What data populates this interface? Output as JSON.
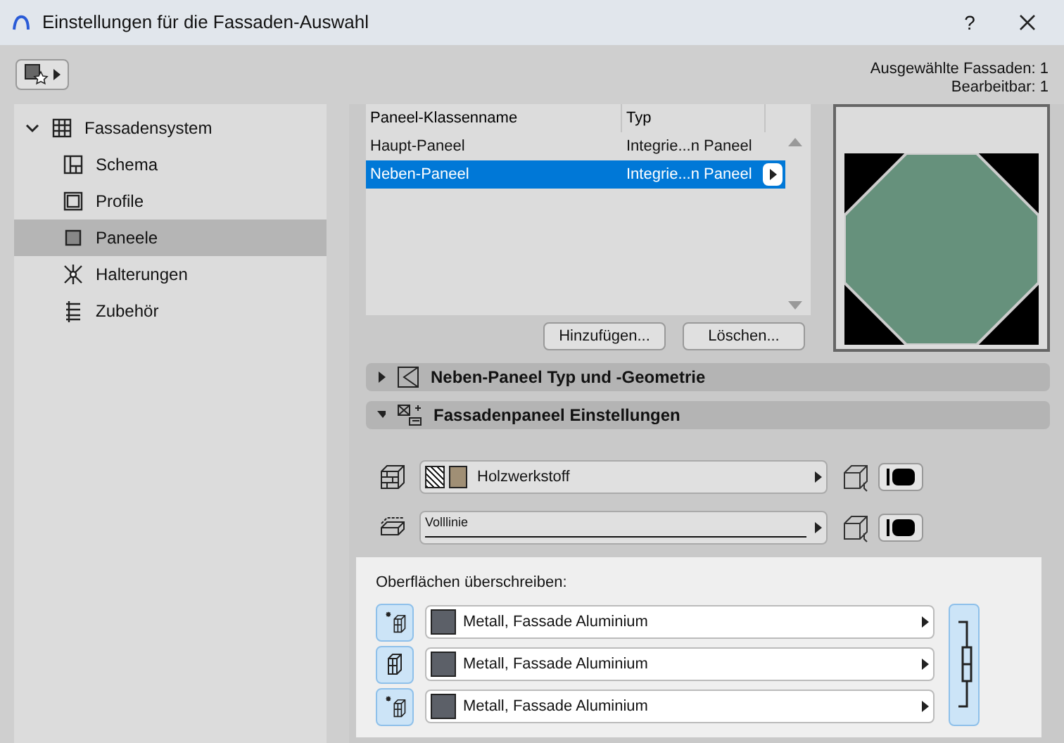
{
  "window": {
    "title": "Einstellungen für die Fassaden-Auswahl",
    "help": "?"
  },
  "info": [
    "Ausgewählte Fassaden: 1",
    "Bearbeitbar: 1"
  ],
  "sidebar": {
    "items": [
      {
        "label": "Fassadensystem",
        "expanded": true,
        "selected": false,
        "children": [
          {
            "label": "Schema",
            "selected": false
          },
          {
            "label": "Profile",
            "selected": false
          },
          {
            "label": "Paneele",
            "selected": true
          },
          {
            "label": "Halterungen",
            "selected": false
          },
          {
            "label": "Zubehör",
            "selected": false
          }
        ]
      }
    ]
  },
  "table": {
    "columns": [
      "Paneel-Klassenname",
      "Typ"
    ],
    "rows": [
      {
        "cells": [
          "Haupt-Paneel",
          "Integrie...n Paneel"
        ],
        "selected": false
      },
      {
        "cells": [
          "Neben-Paneel",
          "Integrie...n Paneel"
        ],
        "selected": true
      }
    ]
  },
  "buttons": [
    "Hinzufügen...",
    "Löschen..."
  ],
  "sections": [
    {
      "title": "Neben-Paneel Typ und -Geometrie",
      "expanded": false
    },
    {
      "title": "Fassadenpaneel Einstellungen",
      "expanded": true
    }
  ],
  "settings": [
    {
      "kind": "material",
      "value": "Holzwerkstoff"
    },
    {
      "kind": "line",
      "value": "Volllinie"
    }
  ],
  "surfaces": {
    "label": "Oberflächen überschreiben:",
    "linked": true,
    "rows": [
      {
        "value": "Metall, Fassade Aluminium"
      },
      {
        "value": "Metall, Fassade Aluminium"
      },
      {
        "value": "Metall, Fassade Aluminium"
      }
    ]
  }
}
